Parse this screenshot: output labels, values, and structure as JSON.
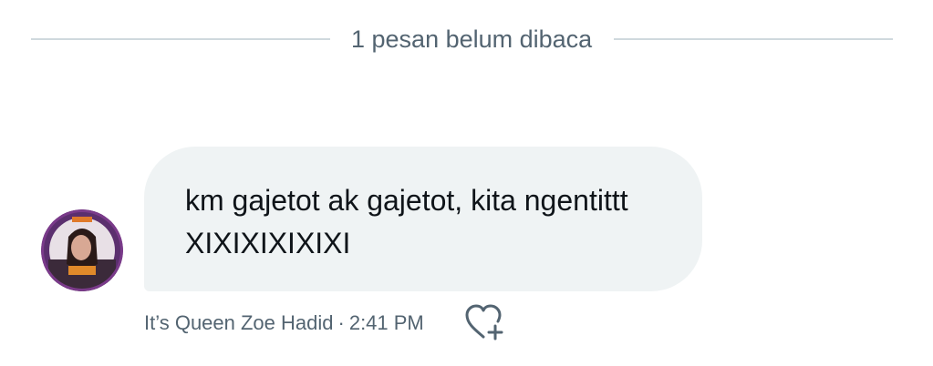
{
  "divider": {
    "text": "1 pesan belum dibaca"
  },
  "message": {
    "text": "km gajetot ak gajetot, kita ngentittt\nXIXIXIXIXIXI",
    "sender": "It’s Queen Zoe Hadid",
    "separator": "·",
    "time": "2:41 PM"
  },
  "icons": {
    "reaction": "heart-plus-icon",
    "avatar": "avatar"
  },
  "colors": {
    "bubble_bg": "#eff3f4",
    "divider_line": "#cfd9de",
    "meta_text": "#536471",
    "message_text": "#0f1419"
  }
}
